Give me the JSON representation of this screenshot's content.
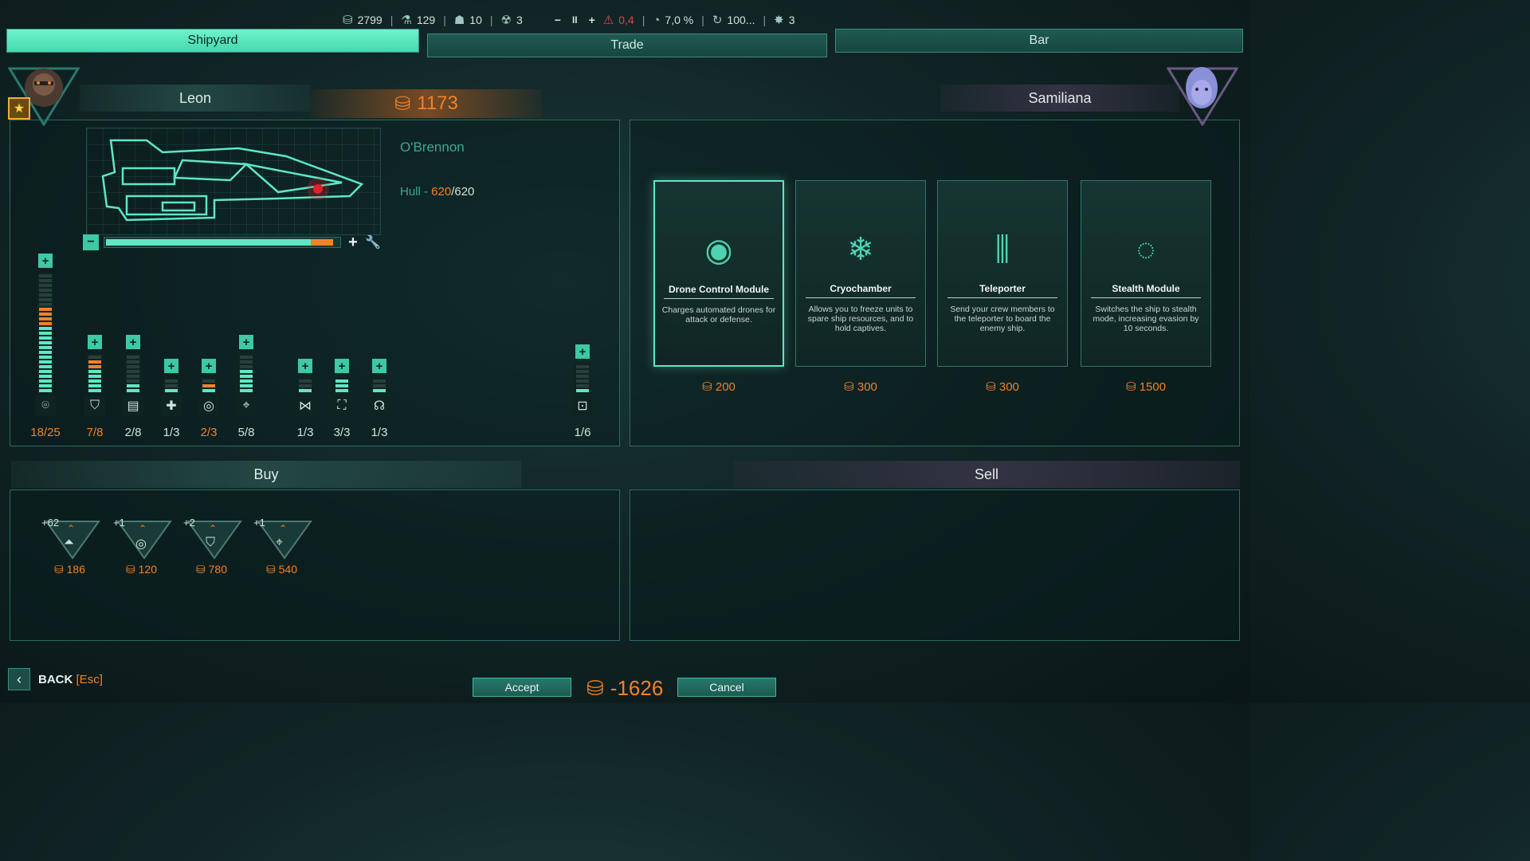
{
  "topbar": {
    "credits": "2799",
    "fuel": "129",
    "crew_food": "10",
    "radiation": "3",
    "speed_minus": "−",
    "pause": "II",
    "speed_plus": "+",
    "threat": "0,4",
    "percent": "7,0 %",
    "cycle": "100...",
    "alert": "3"
  },
  "tabs": {
    "shipyard": "Shipyard",
    "trade": "Trade",
    "bar": "Bar"
  },
  "player": {
    "name": "Leon",
    "coins": "1173"
  },
  "trader": {
    "name": "Samiliana"
  },
  "ship": {
    "name": "O'Brennon",
    "hull_label": "Hull - ",
    "hull_current": "620",
    "hull_max": "/620",
    "hull_fraction": 0.97
  },
  "modules": [
    {
      "name": "power",
      "icon": "⌾",
      "value": "18/25",
      "filled": 18,
      "total": 25,
      "warn": true
    },
    {
      "name": "shield",
      "icon": "⛉",
      "value": "7/8",
      "filled": 7,
      "total": 8,
      "warn": true
    },
    {
      "name": "storage",
      "icon": "▤",
      "value": "2/8",
      "filled": 2,
      "total": 8,
      "warn": false
    },
    {
      "name": "medbay",
      "icon": "✚",
      "value": "1/3",
      "filled": 1,
      "total": 3,
      "warn": false
    },
    {
      "name": "engine",
      "icon": "◎",
      "value": "2/3",
      "filled": 2,
      "total": 3,
      "warn": true
    },
    {
      "name": "targeting",
      "icon": "⌖",
      "value": "5/8",
      "filled": 5,
      "total": 8,
      "warn": false
    },
    {
      "name": "teleport",
      "icon": "⋈",
      "value": "1/3",
      "filled": 1,
      "total": 3,
      "warn": false
    },
    {
      "name": "scanner",
      "icon": "⛶",
      "value": "3/3",
      "filled": 3,
      "total": 3,
      "warn": false
    },
    {
      "name": "life-support",
      "icon": "☊",
      "value": "1/3",
      "filled": 1,
      "total": 3,
      "warn": false
    },
    {
      "name": "special",
      "icon": "⊡",
      "value": "1/6",
      "filled": 1,
      "total": 6,
      "warn": false
    }
  ],
  "cards": [
    {
      "title": "Drone Control Module",
      "icon": "◉",
      "desc": "Charges automated drones for attack or defense.",
      "price": "200",
      "selected": true
    },
    {
      "title": "Cryochamber",
      "icon": "❄",
      "desc": "Allows you to freeze units to spare ship resources, and to hold captives.",
      "price": "300",
      "selected": false
    },
    {
      "title": "Teleporter",
      "icon": "⫼",
      "desc": "Send your crew members to the teleporter to board the enemy ship.",
      "price": "300",
      "selected": false
    },
    {
      "title": "Stealth Module",
      "icon": "◌",
      "desc": "Switches the ship to stealth mode, increasing evasion by 10 seconds.",
      "price": "1500",
      "selected": false
    }
  ],
  "buy": {
    "label": "Buy",
    "items": [
      {
        "count": "+62",
        "icon": "⏶",
        "price": "186"
      },
      {
        "count": "+1",
        "icon": "◎",
        "price": "120"
      },
      {
        "count": "+2",
        "icon": "⛉",
        "price": "780"
      },
      {
        "count": "+1",
        "icon": "⌖",
        "price": "540"
      }
    ]
  },
  "sell": {
    "label": "Sell"
  },
  "footer": {
    "back": "BACK",
    "back_key": "[Esc]",
    "accept": "Accept",
    "cancel": "Cancel",
    "total": "-1626"
  },
  "colors": {
    "accent": "#5fe7c3",
    "price": "#f0822a",
    "warn": "#e0454b"
  }
}
